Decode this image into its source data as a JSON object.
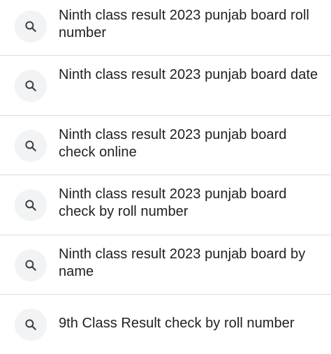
{
  "suggestions": [
    {
      "text": "Ninth class result 2023 punjab board roll number",
      "icon": "search-icon"
    },
    {
      "text": "Ninth class result 2023 punjab board date",
      "icon": "search-icon"
    },
    {
      "text": "Ninth class result 2023 punjab board check online",
      "icon": "search-icon"
    },
    {
      "text": "Ninth class result 2023 punjab board check by roll number",
      "icon": "search-icon"
    },
    {
      "text": "Ninth class result 2023 punjab board by name",
      "icon": "search-icon"
    },
    {
      "text": "9th Class Result check by roll number",
      "icon": "search-icon"
    }
  ],
  "colors": {
    "text": "#202124",
    "icon": "#3c4043",
    "icon_bg": "#f1f3f4",
    "divider": "#dadce0"
  }
}
